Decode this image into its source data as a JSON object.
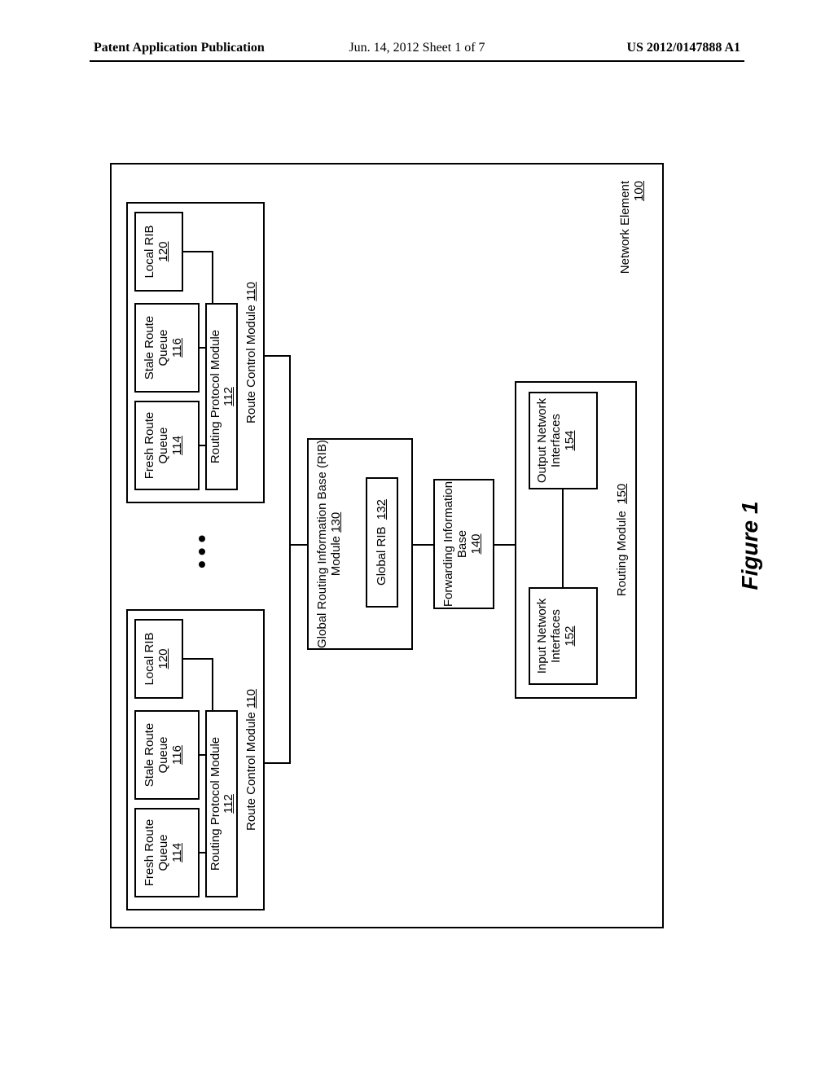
{
  "header": {
    "left": "Patent Application Publication",
    "middle": "Jun. 14, 2012  Sheet 1 of 7",
    "right": "US 2012/0147888 A1"
  },
  "figure": {
    "caption": "Figure 1",
    "network_element": {
      "label": "Network Element",
      "ref": "100"
    },
    "rcm": {
      "label": "Route Control Module",
      "ref": "110",
      "rpm": {
        "label": "Routing Protocol Module",
        "ref": "112"
      },
      "frq": {
        "label": "Fresh Route Queue",
        "ref": "114"
      },
      "srq": {
        "label": "Stale Route Queue",
        "ref": "116"
      },
      "lrib": {
        "label": "Local RIB",
        "ref": "120"
      }
    },
    "gribm": {
      "label": "Global Routing Information Base (RIB) Module",
      "ref": "130",
      "grib": {
        "label": "Global RIB",
        "ref": "132"
      }
    },
    "fib": {
      "label": "Forwarding Information Base",
      "ref": "140"
    },
    "routing_module": {
      "label": "Routing Module",
      "ref": "150",
      "ini": {
        "label": "Input Network Interfaces",
        "ref": "152"
      },
      "oni": {
        "label": "Output Network Interfaces",
        "ref": "154"
      }
    }
  }
}
